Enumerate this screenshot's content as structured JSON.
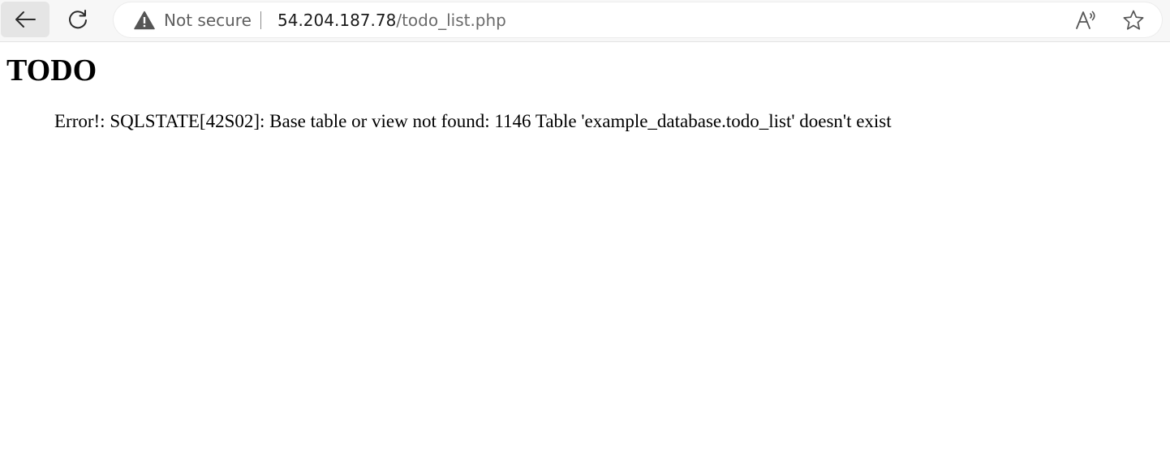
{
  "browser": {
    "back_icon": "arrow-left-icon",
    "reload_icon": "reload-icon",
    "security_icon": "warning-triangle-icon",
    "security_label": "Not secure",
    "url_host": "54.204.187.78",
    "url_path": "/todo_list.php",
    "read_aloud_icon": "read-aloud-icon",
    "favorite_icon": "star-icon"
  },
  "page": {
    "title": "TODO",
    "error_message": "Error!: SQLSTATE[42S02]: Base table or view not found: 1146 Table 'example_database.todo_list' doesn't exist"
  }
}
